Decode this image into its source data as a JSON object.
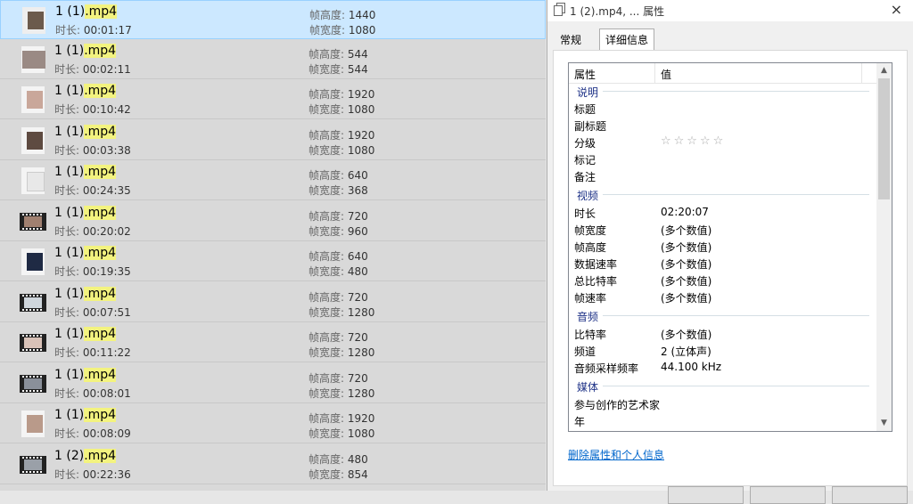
{
  "file_list": {
    "duration_label": "时长: ",
    "height_label": "帧高度: ",
    "width_label": "帧宽度: ",
    "rows": [
      {
        "name_base": "1 (1)",
        "name_ext": ".mp4",
        "duration": "00:01:17",
        "frame_height": "1440",
        "frame_width": "1080",
        "selected": true
      },
      {
        "name_base": "1 (1)",
        "name_ext": ".mp4",
        "duration": "00:02:11",
        "frame_height": "544",
        "frame_width": "544"
      },
      {
        "name_base": "1 (1)",
        "name_ext": ".mp4",
        "duration": "00:10:42",
        "frame_height": "1920",
        "frame_width": "1080"
      },
      {
        "name_base": "1 (1)",
        "name_ext": ".mp4",
        "duration": "00:03:38",
        "frame_height": "1920",
        "frame_width": "1080"
      },
      {
        "name_base": "1 (1)",
        "name_ext": ".mp4",
        "duration": "00:24:35",
        "frame_height": "640",
        "frame_width": "368"
      },
      {
        "name_base": "1 (1)",
        "name_ext": ".mp4",
        "duration": "00:20:02",
        "frame_height": "720",
        "frame_width": "960"
      },
      {
        "name_base": "1 (1)",
        "name_ext": ".mp4",
        "duration": "00:19:35",
        "frame_height": "640",
        "frame_width": "480"
      },
      {
        "name_base": "1 (1)",
        "name_ext": ".mp4",
        "duration": "00:07:51",
        "frame_height": "720",
        "frame_width": "1280"
      },
      {
        "name_base": "1 (1)",
        "name_ext": ".mp4",
        "duration": "00:11:22",
        "frame_height": "720",
        "frame_width": "1280"
      },
      {
        "name_base": "1 (1)",
        "name_ext": ".mp4",
        "duration": "00:08:01",
        "frame_height": "720",
        "frame_width": "1280"
      },
      {
        "name_base": "1 (1)",
        "name_ext": ".mp4",
        "duration": "00:08:09",
        "frame_height": "1920",
        "frame_width": "1080"
      },
      {
        "name_base": "1 (2)",
        "name_ext": ".mp4",
        "duration": "00:22:36",
        "frame_height": "480",
        "frame_width": "854"
      }
    ]
  },
  "properties": {
    "window_title": "1 (2).mp4, ... 属性",
    "close_icon": "×",
    "tabs": [
      "常规",
      "详细信息"
    ],
    "active_tab": "详细信息",
    "columns": {
      "property": "属性",
      "value": "值"
    },
    "groups": {
      "description": {
        "label": "说明",
        "items": [
          {
            "name": "标题",
            "value": ""
          },
          {
            "name": "副标题",
            "value": ""
          },
          {
            "name": "分级",
            "value": ""
          },
          {
            "name": "标记",
            "value": ""
          },
          {
            "name": "备注",
            "value": ""
          }
        ],
        "rating_stars": "☆☆☆☆☆"
      },
      "video": {
        "label": "视频",
        "items": [
          {
            "name": "时长",
            "value": "02:20:07"
          },
          {
            "name": "帧宽度",
            "value": "(多个数值)"
          },
          {
            "name": "帧高度",
            "value": "(多个数值)"
          },
          {
            "name": "数据速率",
            "value": "(多个数值)"
          },
          {
            "name": "总比特率",
            "value": "(多个数值)"
          },
          {
            "name": "帧速率",
            "value": "(多个数值)"
          }
        ]
      },
      "audio": {
        "label": "音频",
        "items": [
          {
            "name": "比特率",
            "value": "(多个数值)"
          },
          {
            "name": "频道",
            "value": "2 (立体声)"
          },
          {
            "name": "音频采样频率",
            "value": "44.100 kHz"
          }
        ]
      },
      "media": {
        "label": "媒体",
        "items": [
          {
            "name": "参与创作的艺术家",
            "value": ""
          },
          {
            "name": "年",
            "value": ""
          }
        ]
      }
    },
    "remove_link": "删除属性和个人信息"
  },
  "colors": {
    "selection": "#cce8ff",
    "extension_highlight": "#f3f37f",
    "group_header": "#1e3287",
    "link": "#0066cc"
  },
  "icons": {
    "window": "copy-icon",
    "scroll_up": "▲",
    "scroll_down": "▼"
  }
}
